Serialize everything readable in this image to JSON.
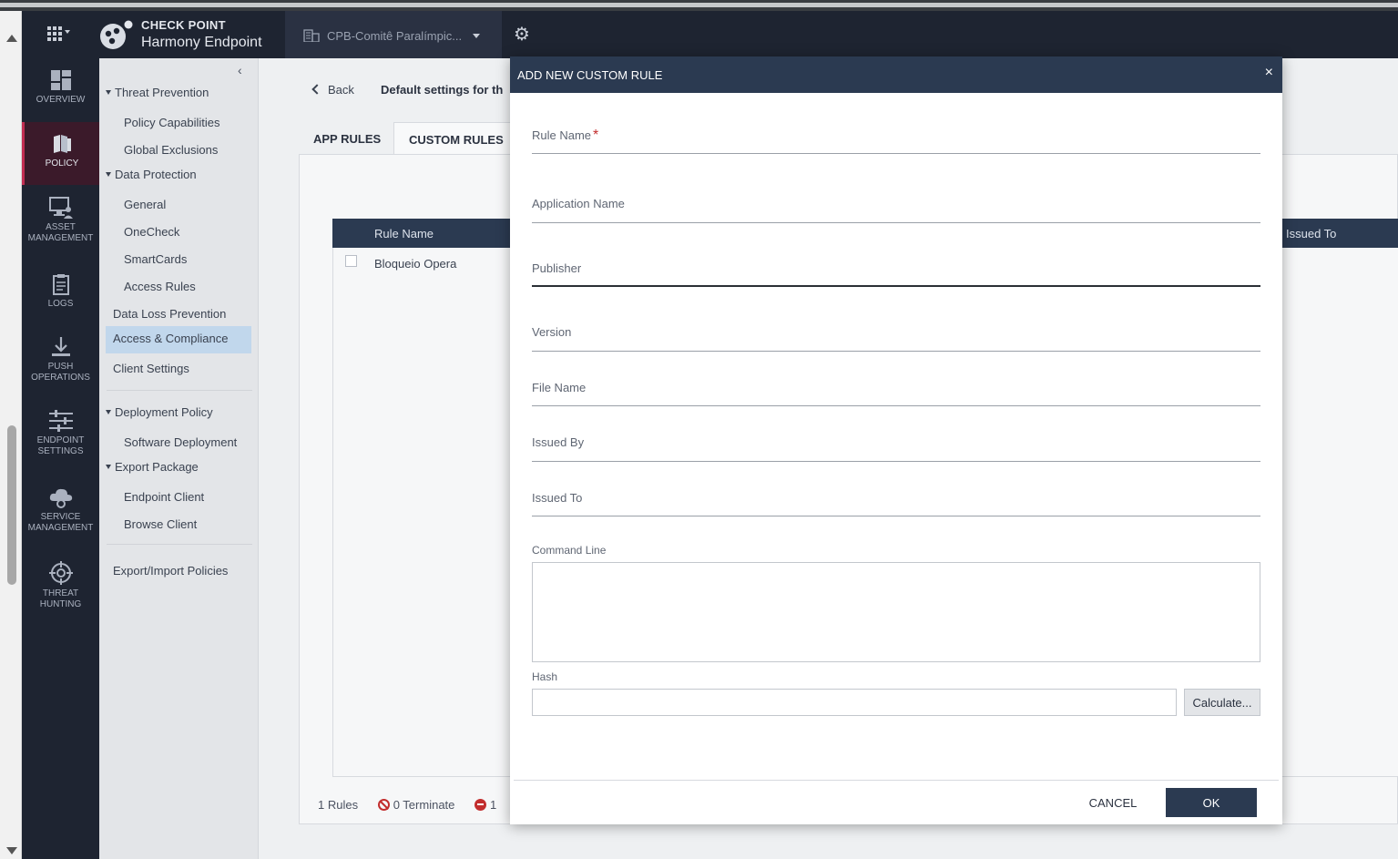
{
  "header": {
    "brand_line1": "CHECK POINT",
    "brand_line2": "Harmony Endpoint",
    "tenant": "CPB-Comitê Paralímpic..."
  },
  "leftnav": {
    "items": [
      {
        "label": "OVERVIEW",
        "icon": "dashboard-icon"
      },
      {
        "label": "POLICY",
        "icon": "policy-icon",
        "active": true
      },
      {
        "label_l1": "ASSET",
        "label_l2": "MANAGEMENT",
        "icon": "monitor-user-icon"
      },
      {
        "label": "LOGS",
        "icon": "clipboard-icon"
      },
      {
        "label_l1": "PUSH",
        "label_l2": "OPERATIONS",
        "icon": "download-icon"
      },
      {
        "label_l1": "ENDPOINT",
        "label_l2": "SETTINGS",
        "icon": "sliders-icon"
      },
      {
        "label_l1": "SERVICE",
        "label_l2": "MANAGEMENT",
        "icon": "cloud-gear-icon"
      },
      {
        "label_l1": "THREAT",
        "label_l2": "HUNTING",
        "icon": "crosshair-icon"
      }
    ]
  },
  "tree": {
    "threat_prevention": "Threat Prevention",
    "policy_capabilities": "Policy Capabilities",
    "global_exclusions": "Global Exclusions",
    "data_protection": "Data Protection",
    "general": "General",
    "onecheck": "OneCheck",
    "smartcards": "SmartCards",
    "access_rules": "Access Rules",
    "data_loss_prevention": "Data Loss Prevention",
    "access_compliance": "Access & Compliance",
    "client_settings": "Client Settings",
    "deployment_policy": "Deployment Policy",
    "software_deployment": "Software Deployment",
    "export_package": "Export Package",
    "endpoint_client": "Endpoint Client",
    "browse_client": "Browse Client",
    "export_import": "Export/Import Policies"
  },
  "main": {
    "back": "Back",
    "title": "Default settings for th",
    "tabs": [
      "APP RULES",
      "CUSTOM RULES"
    ],
    "columns": {
      "rule_name": "Rule Name",
      "issued_to": "Issued To"
    },
    "rows": [
      {
        "name": "Bloqueio Opera"
      }
    ],
    "stats": {
      "rules": "1 Rules",
      "terminate": "0 Terminate",
      "block": "1"
    }
  },
  "modal": {
    "title": "ADD NEW CUSTOM RULE",
    "close": "×",
    "fields": {
      "rule_name": "Rule Name",
      "rule_name_req": "*",
      "application_name": "Application Name",
      "publisher": "Publisher",
      "version": "Version",
      "file_name": "File Name",
      "issued_by": "Issued By",
      "issued_to": "Issued To",
      "command_line": "Command Line",
      "hash": "Hash"
    },
    "calculate": "Calculate...",
    "cancel": "CANCEL",
    "ok": "OK"
  }
}
